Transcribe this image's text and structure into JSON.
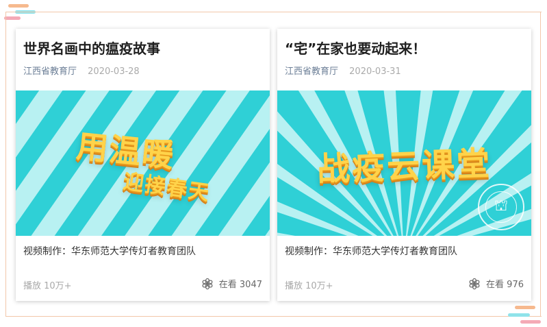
{
  "colors": {
    "frame": "#f3c7a9",
    "deco_orange": "#f6b98e",
    "deco_cyan": "#8fe3ea",
    "deco_pink": "#f4aab6",
    "banner_light": "#b8f1f2",
    "banner_dark": "#2fd0d6",
    "banner_text": "#ffd34a"
  },
  "cards": [
    {
      "title": "世界名画中的瘟疫故事",
      "source": "江西省教育厅",
      "date": "2020-03-28",
      "banner_lines": [
        "用温暖",
        "迎接春天"
      ],
      "banner_style": "diagonal-stripes",
      "author": "视频制作：华东师范大学传灯者教育团队",
      "plays": "播放 10万+",
      "watching": "在看 3047",
      "watching_icon": "flower-icon"
    },
    {
      "title": "“宅”在家也要动起来！",
      "source": "江西省教育厅",
      "date": "2020-03-31",
      "banner_lines": [
        "战疫云课堂"
      ],
      "banner_style": "sunburst",
      "banner_logo": "university-seal-icon",
      "author": "视频制作：华东师范大学传灯者教育团队",
      "plays": "播放 10万+",
      "watching": "在看 976",
      "watching_icon": "flower-icon"
    }
  ]
}
